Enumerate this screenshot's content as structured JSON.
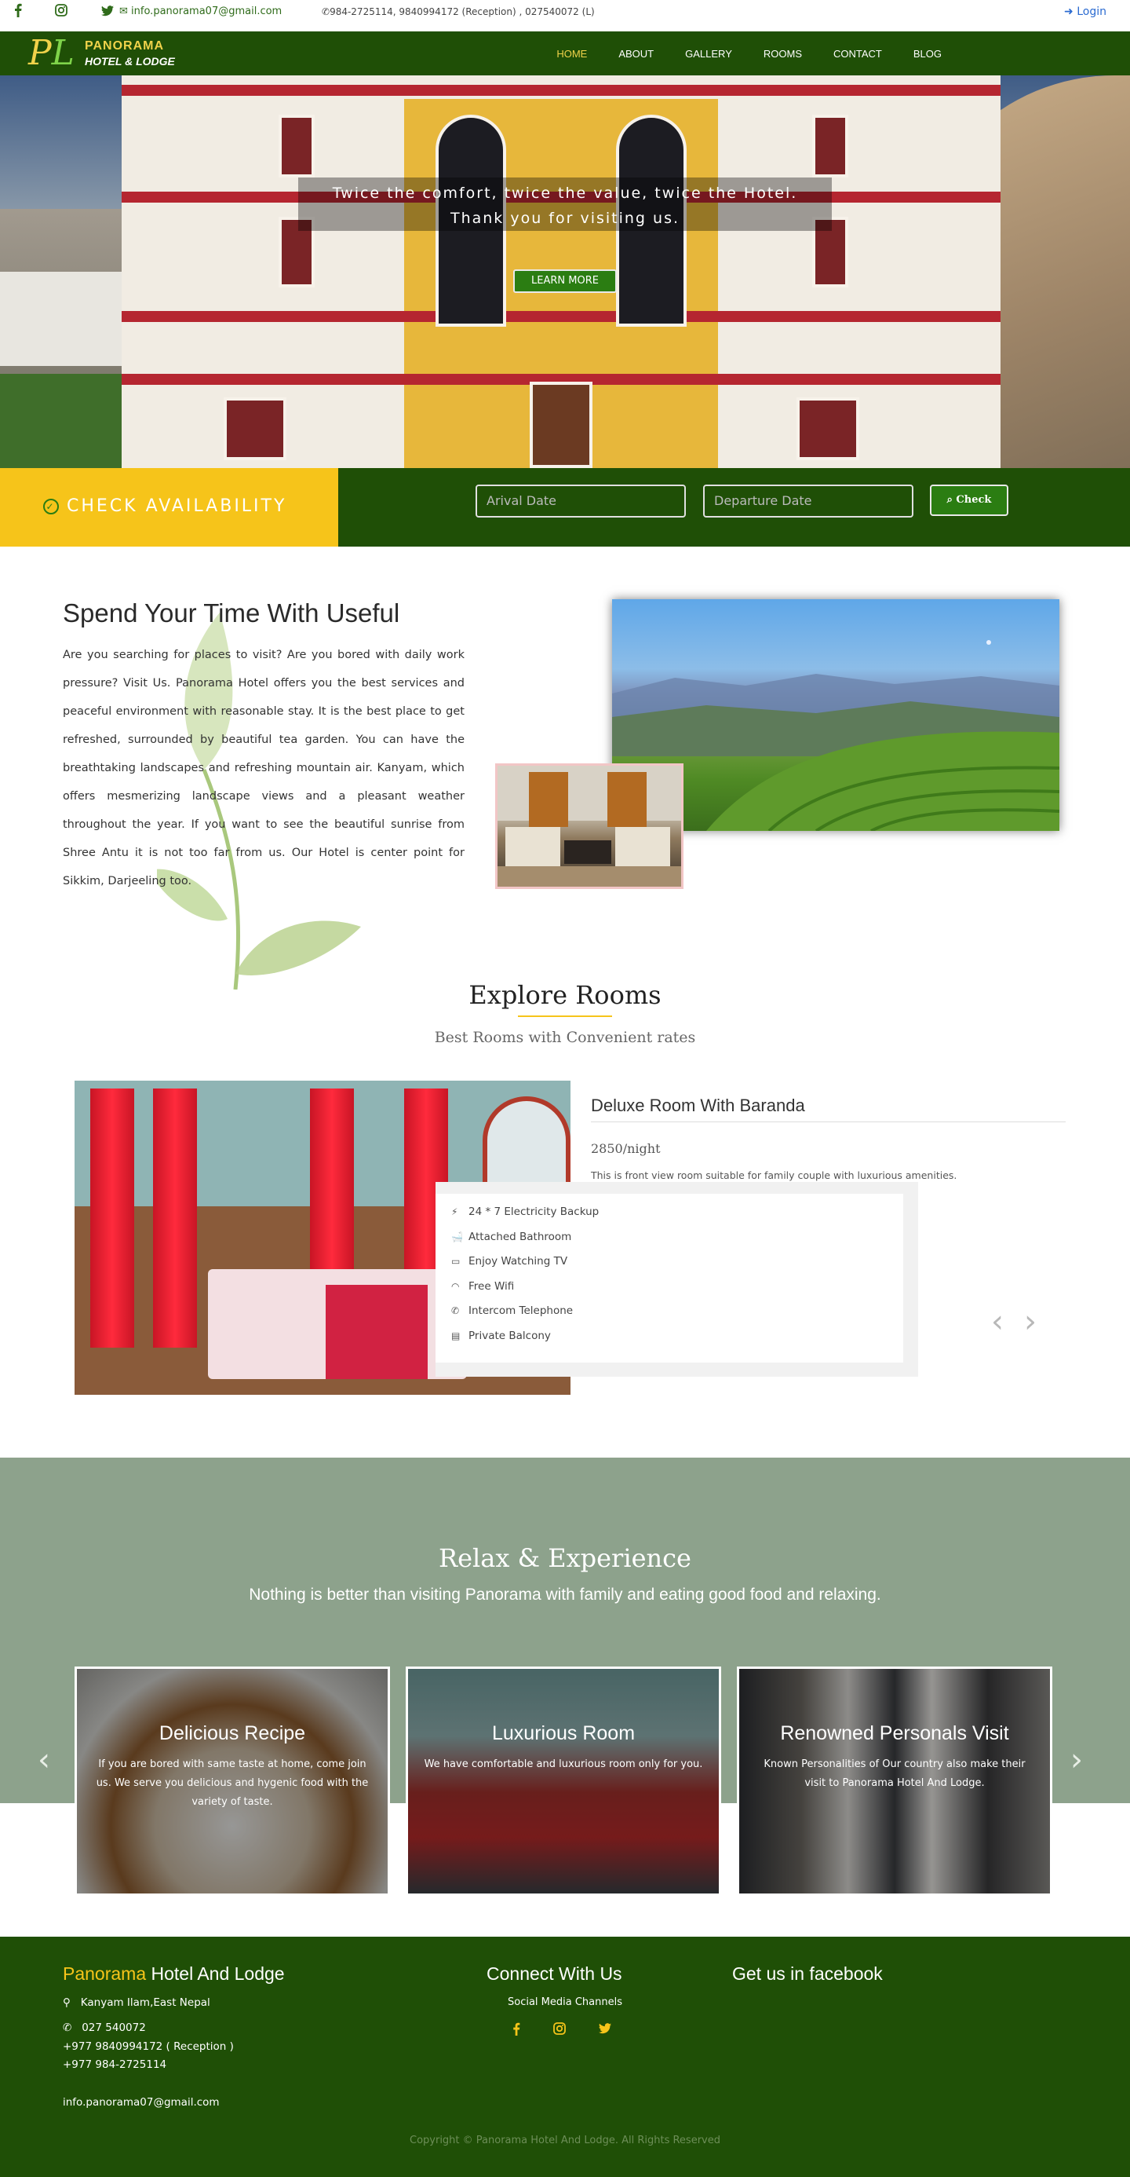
{
  "topbar": {
    "facebook_icon": "f",
    "instagram_icon": "◎",
    "twitter_icon": "🐦",
    "email": "info.panorama07@gmail.com",
    "phone": "984-2725114, 9840994172 (Reception) , 027540072 (L)",
    "login": "Login"
  },
  "brand": {
    "mark": "PL",
    "line1": "PANORAMA",
    "line2": "HOTEL & LODGE"
  },
  "nav": {
    "items": [
      "HOME",
      "ABOUT",
      "GALLERY",
      "ROOMS",
      "CONTACT",
      "BLOG"
    ],
    "active": "HOME"
  },
  "hero": {
    "tagline": "Twice the comfort, twice the value, twice the Hotel. Thank you for visiting us.",
    "button": "LEARN MORE"
  },
  "availability": {
    "label": "CHECK AVAILABILITY",
    "arrival_placeholder": "Arival Date",
    "departure_placeholder": "Departure Date",
    "button": "Check"
  },
  "about": {
    "title": "Spend Your Time With Useful",
    "text": "Are you searching for places to visit? Are you bored with daily work pressure? Visit Us. Panorama Hotel offers you the best services and peaceful environment with reasonable stay. It is the best place to get refreshed, surrounded by beautiful tea garden. You can have the breathtaking landscapes and refreshing mountain air. Kanyam, which offers mesmerizing landscape views and a pleasant weather throughout the year. If you want to see the beautiful sunrise from Shree Antu it is not too far from us. Our Hotel is center point for Sikkim, Darjeeling too."
  },
  "rooms": {
    "title": "Explore Rooms",
    "subtitle": "Best Rooms with Convenient rates",
    "room": {
      "name": "Deluxe Room With Baranda",
      "price": "2850/night",
      "description": "This is front view room suitable for family couple with luxurious amenities.",
      "amenities": [
        "24 * 7 Electricity Backup",
        "Attached Bathroom",
        "Enjoy Watching TV",
        "Free Wifi",
        "Intercom Telephone",
        "Private Balcony"
      ]
    }
  },
  "relax": {
    "title": "Relax & Experience",
    "subtitle": "Nothing is better than visiting Panorama with family and eating good food and relaxing.",
    "cards": [
      {
        "title": "Delicious Recipe",
        "text": "If you are bored with same taste at home, come join us. We serve you delicious and hygenic food with the variety of taste."
      },
      {
        "title": "Luxurious Room",
        "text": "We have comfortable and luxurious room only for you."
      },
      {
        "title": "Renowned Personals Visit",
        "text": "Known Personalities of Our country also make their visit to Panorama Hotel And Lodge."
      }
    ]
  },
  "footer": {
    "brand_highlight": "Panorama",
    "brand_rest": "Hotel And Lodge",
    "address": "Kanyam Ilam,East Nepal",
    "phone1": "027 540072",
    "phone2": "+977 9840994172 ( Reception )",
    "phone3": "+977 984-2725114",
    "email": "info.panorama07@gmail.com",
    "connect_title": "Connect With Us",
    "connect_sub": "Social Media Channels",
    "facebook_title": "Get us in facebook",
    "copyright": "Copyright © Panorama Hotel And Lodge. All Rights Reserved"
  },
  "colors": {
    "nav_green": "#1f4f06",
    "accent_yellow": "#f6c41a",
    "button_green": "#2b7d12",
    "relax_bg": "#8da28c"
  }
}
